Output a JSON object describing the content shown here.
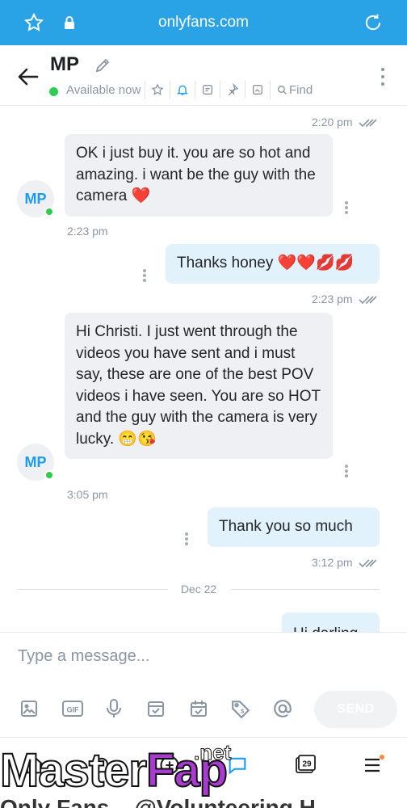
{
  "browser": {
    "url": "onlyfans.com"
  },
  "header": {
    "title": "MP",
    "status": "Available now",
    "find_label": "Find"
  },
  "messages": [
    {
      "time": "2:20 pm"
    },
    {
      "text": "OK i just buy it. you are so hot and amazing. i want be the guy with the camera ❤️",
      "time": "2:23 pm",
      "avatar": "MP"
    },
    {
      "text": "Thanks honey ❤️❤️💋💋",
      "time": "2:23 pm"
    },
    {
      "text": "Hi Christi. I just went through the videos you have sent and i must say, these are one of the best POV videos i have seen. You are so HOT and the guy with the camera is very lucky. 😁😘",
      "time": "3:05 pm",
      "avatar": "MP"
    },
    {
      "text": "Thank you so much",
      "time": "3:12 pm"
    },
    {
      "text": "Hi darling"
    }
  ],
  "date_separator": "Dec 22",
  "composer": {
    "placeholder": "Type a message...",
    "send_label": "SEND"
  },
  "nav": {
    "calendar_badge": "29"
  },
  "watermark": {
    "part1": "Master",
    "part2": "Fap",
    "suffix": ".net"
  },
  "bottom_strip_text": "Only Fans... @Volunteering H",
  "colors": {
    "brand": "#2aa3e6",
    "accent": "#1d9bf0",
    "online": "#2fcc52",
    "out_bubble": "#e1f2fc",
    "in_bubble": "#eef0f3"
  }
}
